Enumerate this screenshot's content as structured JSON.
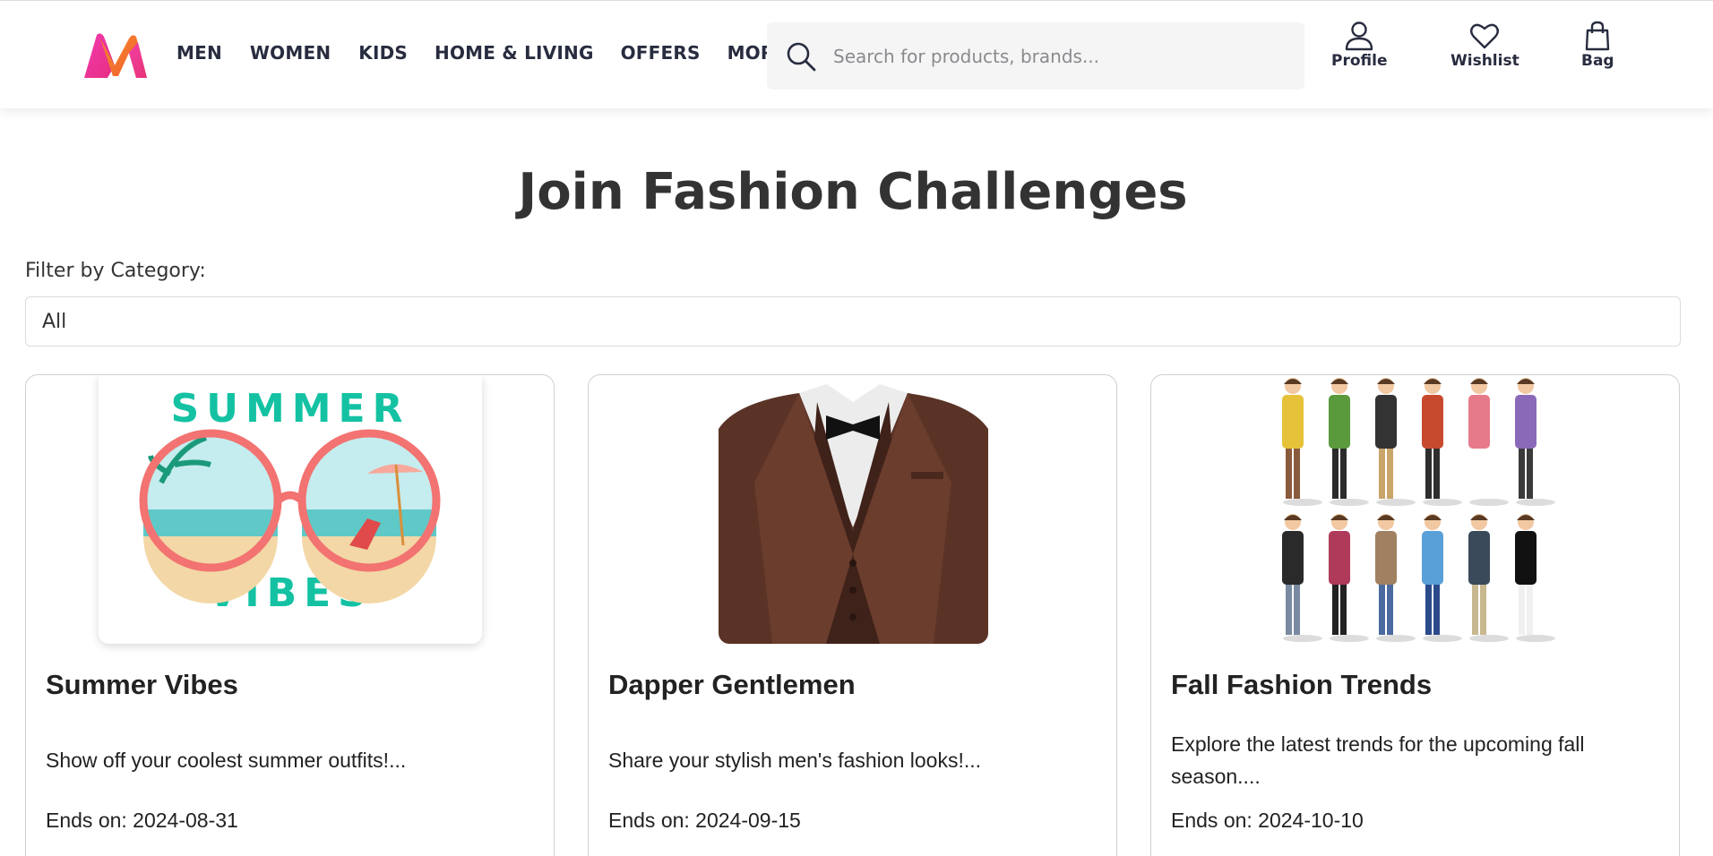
{
  "header": {
    "nav": [
      "MEN",
      "WOMEN",
      "KIDS",
      "HOME & LIVING",
      "OFFERS",
      "MORE"
    ],
    "search_placeholder": "Search for products, brands...",
    "actions": {
      "profile": "Profile",
      "wishlist": "Wishlist",
      "bag": "Bag"
    }
  },
  "page": {
    "title": "Join Fashion Challenges",
    "filter_label": "Filter by Category:",
    "filter_value": "All"
  },
  "challenges": [
    {
      "image_text_top": "SUMMER",
      "image_text_bottom": "VIBES",
      "title": "Summer Vibes",
      "description": "Show off your coolest summer outfits!...",
      "ends": "Ends on: 2024-08-31"
    },
    {
      "title": "Dapper Gentlemen",
      "description": "Share your stylish men's fashion looks!...",
      "ends": "Ends on: 2024-09-15"
    },
    {
      "title": "Fall Fashion Trends",
      "description": "Explore the latest trends for the upcoming fall season....",
      "ends": "Ends on: 2024-10-10"
    }
  ],
  "colors": {
    "brand_pink": "#e72e7f",
    "brand_orange": "#f47d33",
    "summer_teal": "#14c2a3",
    "summer_coral": "#f27371"
  },
  "icons": [
    "myntra-logo",
    "search-icon",
    "profile-icon",
    "heart-icon",
    "bag-icon"
  ]
}
